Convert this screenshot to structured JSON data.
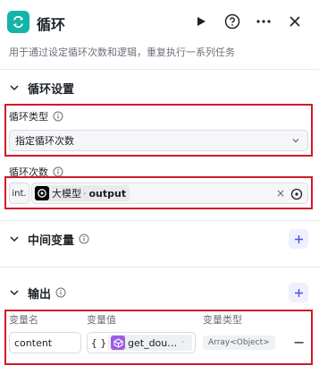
{
  "header": {
    "title": "循环",
    "icons": [
      "loop-icon",
      "play-icon",
      "help-icon",
      "more-icon",
      "close-icon"
    ],
    "subtitle": "用于通过设定循环次数和逻辑，重复执行一系列任务"
  },
  "loop_settings": {
    "title": "循环设置",
    "type_label": "循环类型",
    "type_value": "指定循环次数",
    "count_label": "循环次数",
    "count_type_tag": "int.",
    "count_ref_node": "大模型",
    "count_ref_separator": "·",
    "count_ref_output": "output",
    "clear_symbol": "×"
  },
  "intermediate_vars": {
    "title": "中间变量"
  },
  "output": {
    "title": "输出",
    "columns": [
      "变量名",
      "变量值",
      "变量类型"
    ],
    "rows": [
      {
        "name": "content",
        "value_tag": "{ }",
        "value_ref": "get_dou…",
        "value_more": "·",
        "type": "Array<Object>",
        "remove_symbol": "−"
      }
    ]
  },
  "colors": {
    "accent": "#14b4a8",
    "highlight_border": "#d11a2a",
    "plus_icon": "#4d53e8"
  }
}
